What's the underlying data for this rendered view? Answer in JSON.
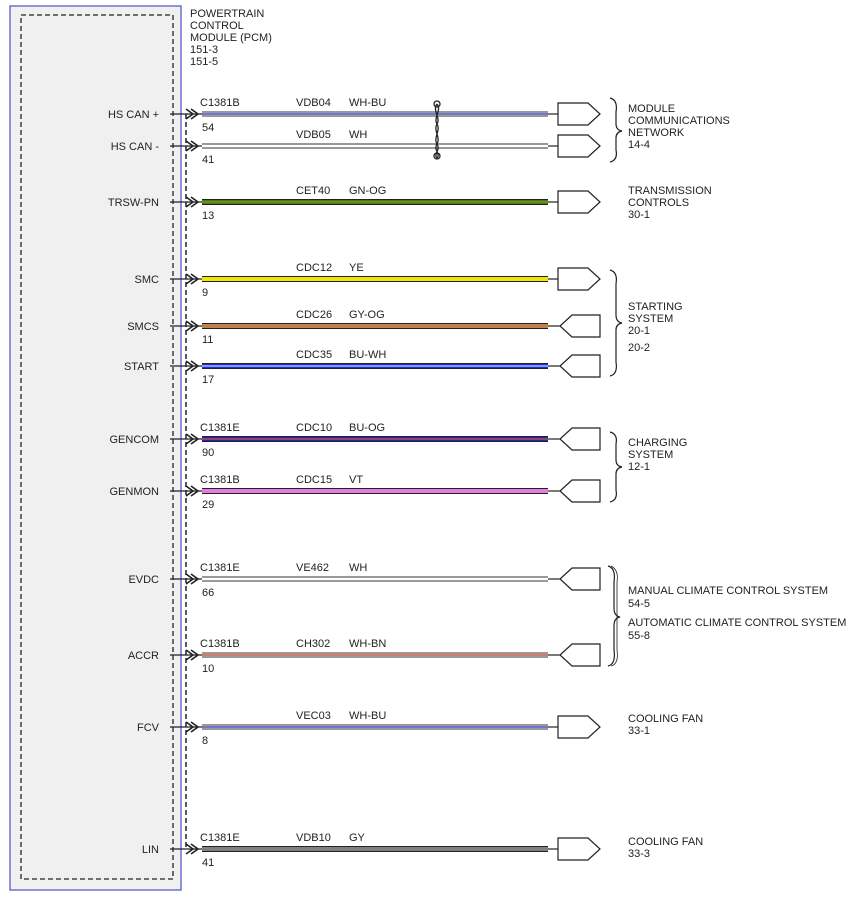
{
  "module": {
    "title_lines": [
      "POWERTRAIN",
      "CONTROL",
      "MODULE (PCM)",
      "151-3",
      "151-5"
    ]
  },
  "circuits": [
    {
      "pin_label": "HS CAN +",
      "connector": "C1381B",
      "circuit": "VDB04",
      "color_code": "WH-BU",
      "pin": "54",
      "wire_colors": [
        "#ffffff",
        "#3b4cc0"
      ],
      "wire_style": "thin",
      "arrow": "out"
    },
    {
      "pin_label": "HS CAN -",
      "connector": "",
      "circuit": "VDB05",
      "color_code": "WH",
      "pin": "41",
      "wire_colors": [
        "#ffffff"
      ],
      "wire_style": "thin",
      "arrow": "out"
    },
    {
      "pin_label": "TRSW-PN",
      "connector": "",
      "circuit": "CET40",
      "color_code": "GN-OG",
      "pin": "13",
      "wire_colors": [
        "#2e8b1a",
        "#e07020"
      ],
      "wire_style": "thick",
      "arrow": "out"
    },
    {
      "pin_label": "SMC",
      "connector": "",
      "circuit": "CDC12",
      "color_code": "YE",
      "pin": "9",
      "wire_colors": [
        "#f2e600"
      ],
      "wire_style": "thick",
      "arrow": "out"
    },
    {
      "pin_label": "SMCS",
      "connector": "",
      "circuit": "CDC26",
      "color_code": "GY-OG",
      "pin": "11",
      "wire_colors": [
        "#b08a5a",
        "#e07020"
      ],
      "wire_style": "thick",
      "arrow": "in"
    },
    {
      "pin_label": "START",
      "connector": "",
      "circuit": "CDC35",
      "color_code": "BU-WH",
      "pin": "17",
      "wire_colors": [
        "#1a2fe0",
        "#ffffff"
      ],
      "wire_style": "thick",
      "arrow": "in"
    },
    {
      "pin_label": "GENCOM",
      "connector": "C1381E",
      "circuit": "CDC10",
      "color_code": "BU-OG",
      "pin": "90",
      "wire_colors": [
        "#2a1fc0",
        "#e07020"
      ],
      "wire_style": "thick",
      "arrow": "in"
    },
    {
      "pin_label": "GENMON",
      "connector": "C1381B",
      "circuit": "CDC15",
      "color_code": "VT",
      "pin": "29",
      "wire_colors": [
        "#e080e0"
      ],
      "wire_style": "thick",
      "arrow": "in"
    },
    {
      "pin_label": "EVDC",
      "connector": "C1381E",
      "circuit": "VE462",
      "color_code": "WH",
      "pin": "66",
      "wire_colors": [
        "#ffffff"
      ],
      "wire_style": "thin",
      "arrow": "in"
    },
    {
      "pin_label": "ACCR",
      "connector": "C1381B",
      "circuit": "CH302",
      "color_code": "WH-BN",
      "pin": "10",
      "wire_colors": [
        "#ffffff",
        "#c05040"
      ],
      "wire_style": "thin",
      "arrow": "in"
    },
    {
      "pin_label": "FCV",
      "connector": "",
      "circuit": "VEC03",
      "color_code": "WH-BU",
      "pin": "8",
      "wire_colors": [
        "#ffffff",
        "#3b4cc0"
      ],
      "wire_style": "thin",
      "arrow": "out"
    },
    {
      "pin_label": "LIN",
      "connector": "C1381E",
      "circuit": "VDB10",
      "color_code": "GY",
      "pin": "41",
      "wire_colors": [
        "#808080"
      ],
      "wire_style": "thick",
      "arrow": "out"
    }
  ],
  "destinations": [
    {
      "lines": [
        "MODULE",
        "COMMUNICATIONS",
        "NETWORK",
        "14-4"
      ]
    },
    {
      "lines": [
        "TRANSMISSION",
        "CONTROLS",
        "30-1"
      ]
    },
    {
      "lines": [
        "STARTING",
        "SYSTEM",
        "20-1",
        "20-2"
      ]
    },
    {
      "lines": [
        "CHARGING",
        "SYSTEM",
        "12-1"
      ]
    },
    {
      "lines": [
        "MANUAL CLIMATE CONTROL SYSTEM",
        "54-5"
      ]
    },
    {
      "lines": [
        "AUTOMATIC CLIMATE CONTROL SYSTEM",
        "55-8"
      ]
    },
    {
      "lines": [
        "COOLING FAN",
        "33-1"
      ]
    },
    {
      "lines": [
        "COOLING FAN",
        "33-3"
      ]
    }
  ],
  "colors": {
    "module_border": "#4a50c8",
    "module_fill": "#f0f0f0",
    "line": "#333333"
  }
}
